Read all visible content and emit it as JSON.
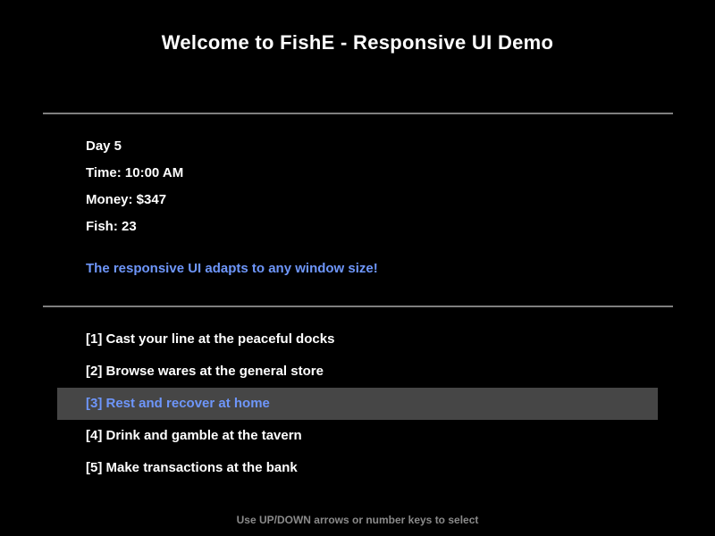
{
  "title": "Welcome to FishE - Responsive UI Demo",
  "stats": {
    "day": "Day 5",
    "time": "Time: 10:00 AM",
    "money": "Money: $347",
    "fish": "Fish: 23"
  },
  "tagline": "The responsive UI adapts to any window size!",
  "menu": {
    "selected_index": 2,
    "items": [
      {
        "label": "[1] Cast your line at the peaceful docks"
      },
      {
        "label": "[2] Browse wares at the general store"
      },
      {
        "label": "[3] Rest and recover at home"
      },
      {
        "label": "[4] Drink and gamble at the tavern"
      },
      {
        "label": "[5] Make transactions at the bank"
      }
    ]
  },
  "hint": "Use UP/DOWN arrows or number keys to select",
  "colors": {
    "background": "#000000",
    "text": "#ffffff",
    "accent": "#6e96fa",
    "selection_bg": "#464646",
    "divider": "#7f7f7f",
    "hint": "#8a8a8a"
  }
}
